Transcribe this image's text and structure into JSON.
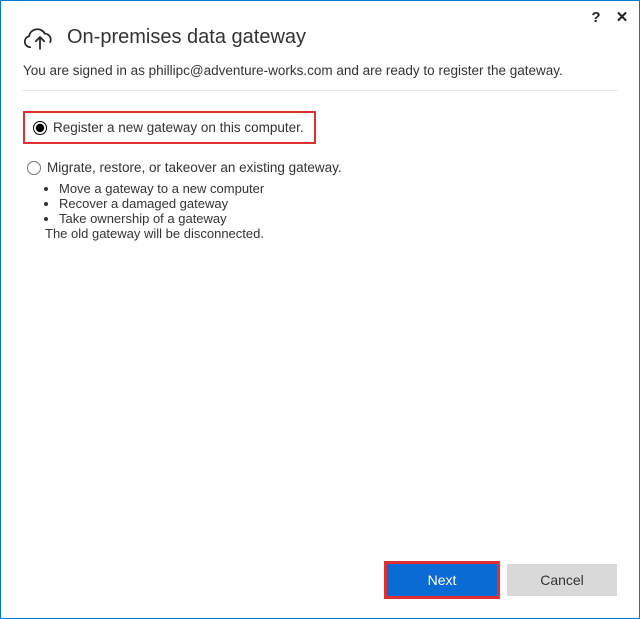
{
  "window": {
    "title": "On-premises data gateway"
  },
  "titlebar": {
    "help_glyph": "?",
    "close_glyph": "✕"
  },
  "signin": {
    "prefix": "You are signed in as ",
    "email": "phillipc@adventure-works.com",
    "suffix": " and are ready to register the gateway."
  },
  "options": {
    "register": {
      "label": "Register a new gateway on this computer.",
      "selected": true
    },
    "migrate": {
      "label": "Migrate, restore, or takeover an existing gateway.",
      "bullets": [
        "Move a gateway to a new computer",
        "Recover a damaged gateway",
        "Take ownership of a gateway"
      ],
      "note": "The old gateway will be disconnected."
    }
  },
  "buttons": {
    "next": "Next",
    "cancel": "Cancel"
  }
}
